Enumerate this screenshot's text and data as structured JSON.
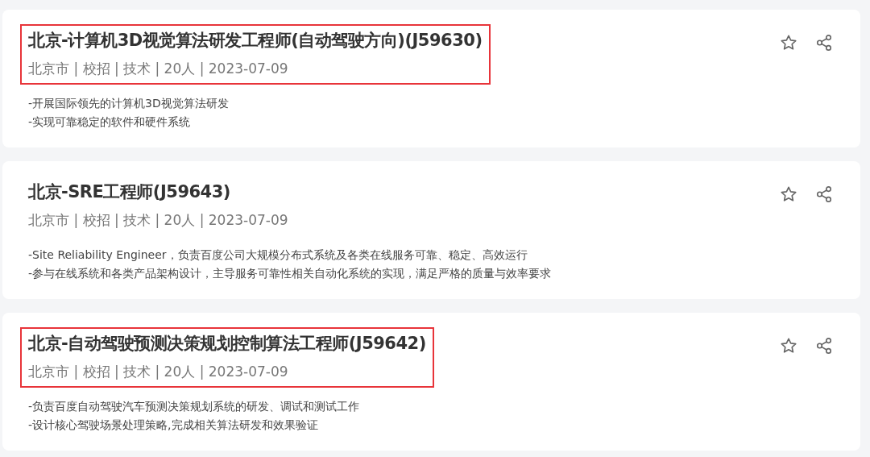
{
  "jobs": [
    {
      "title": "北京-计算机3D视觉算法研发工程师(自动驾驶方向)(J59630)",
      "meta": "北京市 | 校招 | 技术 | 20人 | 2023-07-09",
      "highlighted": true,
      "description": [
        "-开展国际领先的计算机3D视觉算法研发",
        "-实现可靠稳定的软件和硬件系统"
      ]
    },
    {
      "title": "北京-SRE工程师(J59643)",
      "meta": "北京市 | 校招 | 技术 | 20人 | 2023-07-09",
      "highlighted": false,
      "description": [
        "-Site Reliability Engineer，负责百度公司大规模分布式系统及各类在线服务可靠、稳定、高效运行",
        "-参与在线系统和各类产品架构设计，主导服务可靠性相关自动化系统的实现，满足严格的质量与效率要求"
      ]
    },
    {
      "title": "北京-自动驾驶预测决策规划控制算法工程师(J59642)",
      "meta": "北京市 | 校招 | 技术 | 20人 | 2023-07-09",
      "highlighted": true,
      "description": [
        "-负责百度自动驾驶汽车预测决策规划系统的研发、调试和测试工作",
        "-设计核心驾驶场景处理策略,完成相关算法研发和效果验证"
      ]
    }
  ]
}
